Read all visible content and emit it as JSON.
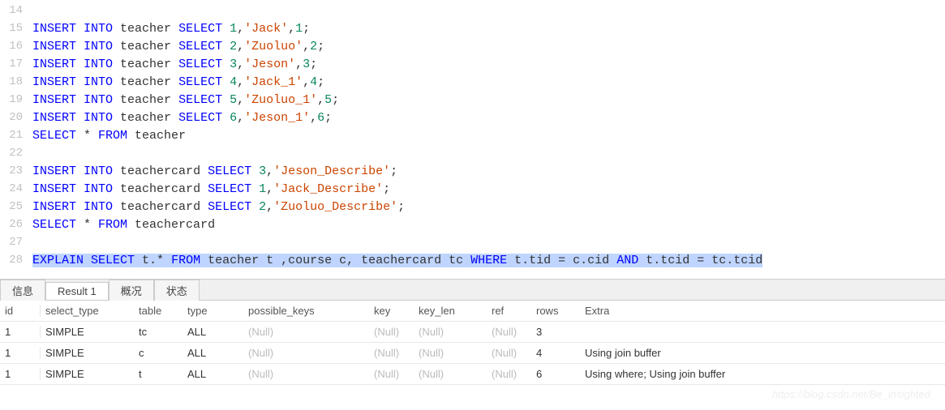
{
  "editor": {
    "lines": [
      {
        "num": "14",
        "tokens": []
      },
      {
        "num": "15",
        "tokens": [
          {
            "t": "INSERT",
            "c": "kw-insert"
          },
          {
            "t": " ",
            "c": "ident"
          },
          {
            "t": "INTO",
            "c": "kw-into"
          },
          {
            "t": " teacher ",
            "c": "ident"
          },
          {
            "t": "SELECT",
            "c": "kw-select"
          },
          {
            "t": " ",
            "c": "ident"
          },
          {
            "t": "1",
            "c": "num"
          },
          {
            "t": ",",
            "c": "punct"
          },
          {
            "t": "'Jack'",
            "c": "str"
          },
          {
            "t": ",",
            "c": "punct"
          },
          {
            "t": "1",
            "c": "num"
          },
          {
            "t": ";",
            "c": "punct"
          }
        ]
      },
      {
        "num": "16",
        "tokens": [
          {
            "t": "INSERT",
            "c": "kw-insert"
          },
          {
            "t": " ",
            "c": "ident"
          },
          {
            "t": "INTO",
            "c": "kw-into"
          },
          {
            "t": " teacher ",
            "c": "ident"
          },
          {
            "t": "SELECT",
            "c": "kw-select"
          },
          {
            "t": " ",
            "c": "ident"
          },
          {
            "t": "2",
            "c": "num"
          },
          {
            "t": ",",
            "c": "punct"
          },
          {
            "t": "'Zuoluo'",
            "c": "str"
          },
          {
            "t": ",",
            "c": "punct"
          },
          {
            "t": "2",
            "c": "num"
          },
          {
            "t": ";",
            "c": "punct"
          }
        ]
      },
      {
        "num": "17",
        "tokens": [
          {
            "t": "INSERT",
            "c": "kw-insert"
          },
          {
            "t": " ",
            "c": "ident"
          },
          {
            "t": "INTO",
            "c": "kw-into"
          },
          {
            "t": " teacher ",
            "c": "ident"
          },
          {
            "t": "SELECT",
            "c": "kw-select"
          },
          {
            "t": " ",
            "c": "ident"
          },
          {
            "t": "3",
            "c": "num"
          },
          {
            "t": ",",
            "c": "punct"
          },
          {
            "t": "'Jeson'",
            "c": "str"
          },
          {
            "t": ",",
            "c": "punct"
          },
          {
            "t": "3",
            "c": "num"
          },
          {
            "t": ";",
            "c": "punct"
          }
        ]
      },
      {
        "num": "18",
        "tokens": [
          {
            "t": "INSERT",
            "c": "kw-insert"
          },
          {
            "t": " ",
            "c": "ident"
          },
          {
            "t": "INTO",
            "c": "kw-into"
          },
          {
            "t": " teacher ",
            "c": "ident"
          },
          {
            "t": "SELECT",
            "c": "kw-select"
          },
          {
            "t": " ",
            "c": "ident"
          },
          {
            "t": "4",
            "c": "num"
          },
          {
            "t": ",",
            "c": "punct"
          },
          {
            "t": "'Jack_1'",
            "c": "str"
          },
          {
            "t": ",",
            "c": "punct"
          },
          {
            "t": "4",
            "c": "num"
          },
          {
            "t": ";",
            "c": "punct"
          }
        ]
      },
      {
        "num": "19",
        "tokens": [
          {
            "t": "INSERT",
            "c": "kw-insert"
          },
          {
            "t": " ",
            "c": "ident"
          },
          {
            "t": "INTO",
            "c": "kw-into"
          },
          {
            "t": " teacher ",
            "c": "ident"
          },
          {
            "t": "SELECT",
            "c": "kw-select"
          },
          {
            "t": " ",
            "c": "ident"
          },
          {
            "t": "5",
            "c": "num"
          },
          {
            "t": ",",
            "c": "punct"
          },
          {
            "t": "'Zuoluo_1'",
            "c": "str"
          },
          {
            "t": ",",
            "c": "punct"
          },
          {
            "t": "5",
            "c": "num"
          },
          {
            "t": ";",
            "c": "punct"
          }
        ]
      },
      {
        "num": "20",
        "tokens": [
          {
            "t": "INSERT",
            "c": "kw-insert"
          },
          {
            "t": " ",
            "c": "ident"
          },
          {
            "t": "INTO",
            "c": "kw-into"
          },
          {
            "t": " teacher ",
            "c": "ident"
          },
          {
            "t": "SELECT",
            "c": "kw-select"
          },
          {
            "t": " ",
            "c": "ident"
          },
          {
            "t": "6",
            "c": "num"
          },
          {
            "t": ",",
            "c": "punct"
          },
          {
            "t": "'Jeson_1'",
            "c": "str"
          },
          {
            "t": ",",
            "c": "punct"
          },
          {
            "t": "6",
            "c": "num"
          },
          {
            "t": ";",
            "c": "punct"
          }
        ]
      },
      {
        "num": "21",
        "tokens": [
          {
            "t": "SELECT",
            "c": "kw-select"
          },
          {
            "t": " * ",
            "c": "ident"
          },
          {
            "t": "FROM",
            "c": "kw-from"
          },
          {
            "t": " teacher",
            "c": "ident"
          }
        ]
      },
      {
        "num": "22",
        "tokens": []
      },
      {
        "num": "23",
        "tokens": [
          {
            "t": "INSERT",
            "c": "kw-insert"
          },
          {
            "t": " ",
            "c": "ident"
          },
          {
            "t": "INTO",
            "c": "kw-into"
          },
          {
            "t": " teachercard ",
            "c": "ident"
          },
          {
            "t": "SELECT",
            "c": "kw-select"
          },
          {
            "t": " ",
            "c": "ident"
          },
          {
            "t": "3",
            "c": "num"
          },
          {
            "t": ",",
            "c": "punct"
          },
          {
            "t": "'Jeson_Describe'",
            "c": "str"
          },
          {
            "t": ";",
            "c": "punct"
          }
        ]
      },
      {
        "num": "24",
        "tokens": [
          {
            "t": "INSERT",
            "c": "kw-insert"
          },
          {
            "t": " ",
            "c": "ident"
          },
          {
            "t": "INTO",
            "c": "kw-into"
          },
          {
            "t": " teachercard ",
            "c": "ident"
          },
          {
            "t": "SELECT",
            "c": "kw-select"
          },
          {
            "t": " ",
            "c": "ident"
          },
          {
            "t": "1",
            "c": "num"
          },
          {
            "t": ",",
            "c": "punct"
          },
          {
            "t": "'Jack_Describe'",
            "c": "str"
          },
          {
            "t": ";",
            "c": "punct"
          }
        ]
      },
      {
        "num": "25",
        "tokens": [
          {
            "t": "INSERT",
            "c": "kw-insert"
          },
          {
            "t": " ",
            "c": "ident"
          },
          {
            "t": "INTO",
            "c": "kw-into"
          },
          {
            "t": " teachercard ",
            "c": "ident"
          },
          {
            "t": "SELECT",
            "c": "kw-select"
          },
          {
            "t": " ",
            "c": "ident"
          },
          {
            "t": "2",
            "c": "num"
          },
          {
            "t": ",",
            "c": "punct"
          },
          {
            "t": "'Zuoluo_Describe'",
            "c": "str"
          },
          {
            "t": ";",
            "c": "punct"
          }
        ]
      },
      {
        "num": "26",
        "tokens": [
          {
            "t": "SELECT",
            "c": "kw-select"
          },
          {
            "t": " * ",
            "c": "ident"
          },
          {
            "t": "FROM",
            "c": "kw-from"
          },
          {
            "t": " teachercard",
            "c": "ident"
          }
        ]
      },
      {
        "num": "27",
        "tokens": []
      },
      {
        "num": "28",
        "highlighted": true,
        "tokens": [
          {
            "t": "EXPLAIN",
            "c": "kw-explain"
          },
          {
            "t": " ",
            "c": "ident"
          },
          {
            "t": "SELECT",
            "c": "kw-select"
          },
          {
            "t": " t.* ",
            "c": "ident"
          },
          {
            "t": "FROM",
            "c": "kw-from"
          },
          {
            "t": " teacher t ,course c, teachercard tc ",
            "c": "ident"
          },
          {
            "t": "WHERE",
            "c": "kw-where"
          },
          {
            "t": " t.tid = c.cid ",
            "c": "ident"
          },
          {
            "t": "AND",
            "c": "kw-and"
          },
          {
            "t": " t.tcid = tc.tcid",
            "c": "ident"
          }
        ]
      }
    ]
  },
  "tabs": {
    "items": [
      {
        "label": "信息",
        "active": false
      },
      {
        "label": "Result 1",
        "active": true
      },
      {
        "label": "概况",
        "active": false
      },
      {
        "label": "状态",
        "active": false
      }
    ]
  },
  "grid": {
    "columns": [
      "id",
      "select_type",
      "table",
      "type",
      "possible_keys",
      "key",
      "key_len",
      "ref",
      "rows",
      "Extra"
    ],
    "rows": [
      {
        "id": "1",
        "select_type": "SIMPLE",
        "table": "tc",
        "type": "ALL",
        "possible_keys": "(Null)",
        "key": "(Null)",
        "key_len": "(Null)",
        "ref": "(Null)",
        "rows": "3",
        "Extra": ""
      },
      {
        "id": "1",
        "select_type": "SIMPLE",
        "table": "c",
        "type": "ALL",
        "possible_keys": "(Null)",
        "key": "(Null)",
        "key_len": "(Null)",
        "ref": "(Null)",
        "rows": "4",
        "Extra": "Using join buffer"
      },
      {
        "id": "1",
        "select_type": "SIMPLE",
        "table": "t",
        "type": "ALL",
        "possible_keys": "(Null)",
        "key": "(Null)",
        "key_len": "(Null)",
        "ref": "(Null)",
        "rows": "6",
        "Extra": "Using where; Using join buffer"
      }
    ],
    "null_text": "(Null)"
  },
  "watermark": "https://blog.csdn.net/Be_insighted"
}
